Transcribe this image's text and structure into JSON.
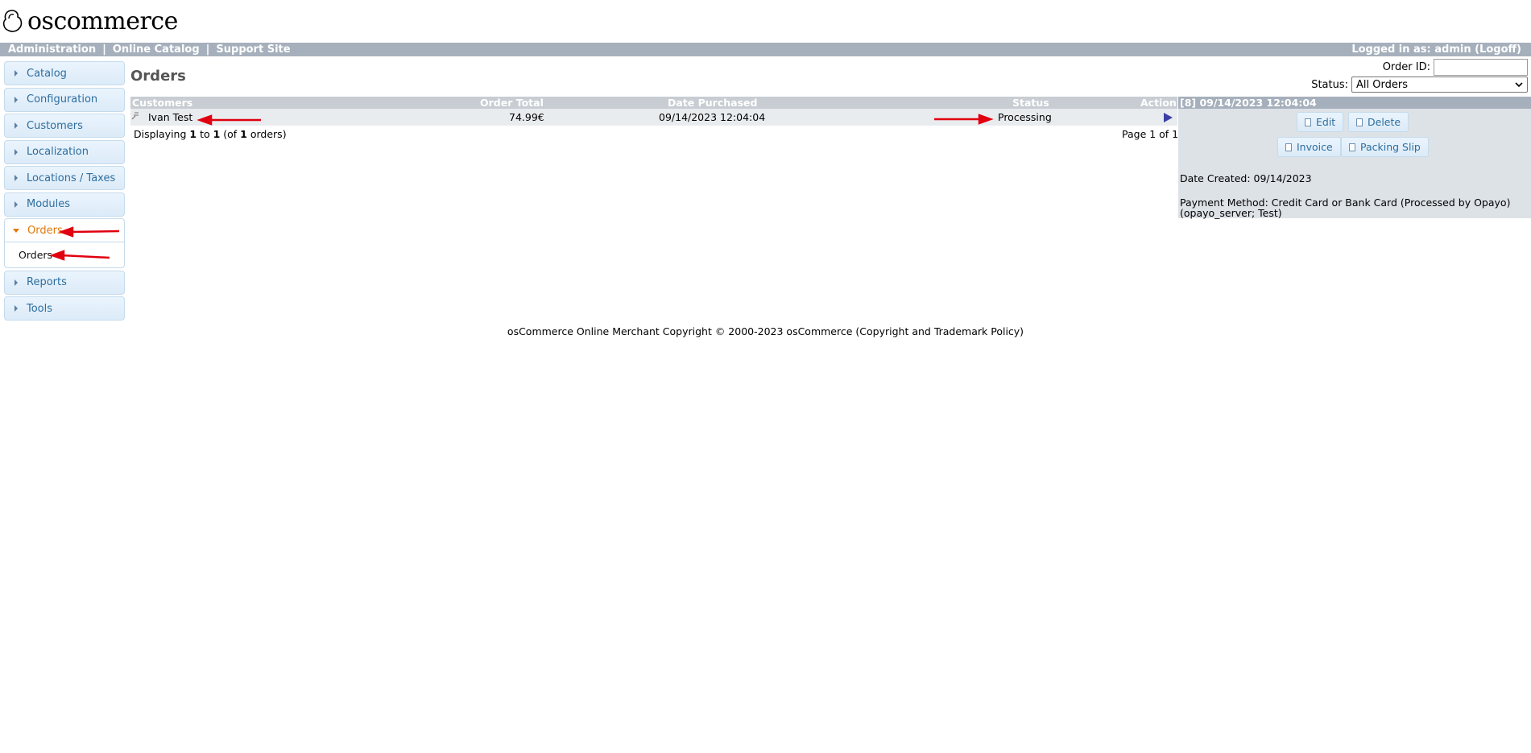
{
  "brand": {
    "name": "oscommerce"
  },
  "topbar": {
    "links": [
      "Administration",
      "Online Catalog",
      "Support Site"
    ],
    "separator": "|",
    "logged_in": "Logged in as: admin (Logoff)"
  },
  "sidebar": {
    "items": [
      {
        "label": "Catalog"
      },
      {
        "label": "Configuration"
      },
      {
        "label": "Customers"
      },
      {
        "label": "Localization"
      },
      {
        "label": "Locations / Taxes"
      },
      {
        "label": "Modules"
      },
      {
        "label": "Orders",
        "active": true
      },
      {
        "label": "Reports"
      },
      {
        "label": "Tools"
      }
    ],
    "sub_items": [
      {
        "label": "Orders"
      }
    ]
  },
  "main": {
    "title": "Orders",
    "order_id_label": "Order ID:",
    "order_id_value": "",
    "status_label": "Status:",
    "status_selected": "All Orders",
    "table": {
      "headers": {
        "customers": "Customers",
        "order_total": "Order Total",
        "date_purchased": "Date Purchased",
        "status": "Status",
        "action": "Action"
      },
      "rows": [
        {
          "customer": "Ivan Test",
          "total": "74.99€",
          "date": "09/14/2023 12:04:04",
          "status": "Processing"
        }
      ],
      "displaying": {
        "prefix": "Displaying ",
        "from": "1",
        "mid": " to ",
        "to": "1",
        "of_prefix": " (of ",
        "count": "1",
        "suffix": " orders)"
      },
      "pagination": "Page 1 of 1"
    },
    "info": {
      "heading": "[8]  09/14/2023 12:04:04",
      "buttons": {
        "edit": "Edit",
        "delete": "Delete",
        "invoice": "Invoice",
        "packing_slip": "Packing Slip"
      },
      "date_created": "Date Created: 09/14/2023",
      "payment_line1": "Payment Method: Credit Card or Bank Card (Processed by Opayo)",
      "payment_line2": "(opayo_server; Test)"
    }
  },
  "footer": {
    "text": "osCommerce Online Merchant Copyright © 2000-2023 osCommerce (Copyright and Trademark Policy)"
  },
  "colors": {
    "accent": "#e1780a",
    "link": "#2e6e9e",
    "annotation": "#e0000f",
    "header_bar": "#a6b0bc"
  }
}
